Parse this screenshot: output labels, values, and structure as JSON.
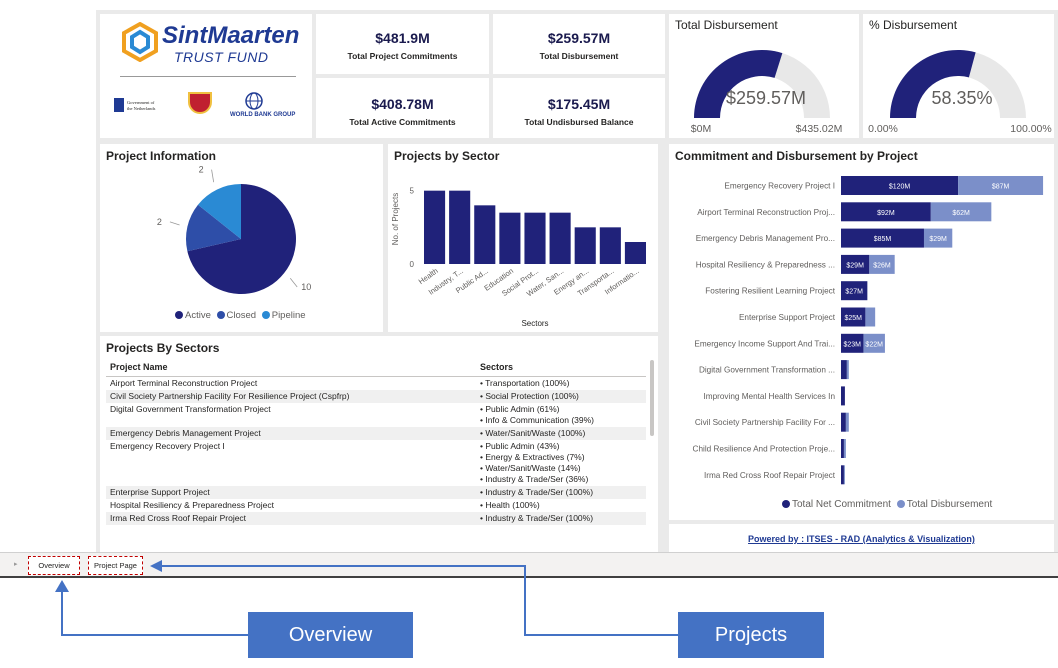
{
  "logo": {
    "name": "SintMaarten",
    "subtitle": "TRUST FUND",
    "partner1_line1": "Government of",
    "partner1_line2": "the Netherlands",
    "partner3": "WORLD BANK GROUP"
  },
  "kpis": {
    "total_project_commitments": {
      "value": "$481.9M",
      "label": "Total Project Commitments"
    },
    "total_disbursement": {
      "value": "$259.57M",
      "label": "Total Disbursement"
    },
    "total_active_commitments": {
      "value": "$408.78M",
      "label": "Total Active Commitments"
    },
    "total_undisbursed": {
      "value": "$175.45M",
      "label": "Total Undisbursed Balance"
    }
  },
  "gauge_disbursement": {
    "title": "Total Disbursement",
    "value": "$259.57M",
    "min": "$0M",
    "max": "$435.02M",
    "fraction": 0.5967
  },
  "gauge_percent": {
    "title": "% Disbursement",
    "value": "58.35%",
    "min": "0.00%",
    "max": "100.00%",
    "fraction": 0.5835
  },
  "project_info": {
    "title": "Project Information",
    "legend": [
      "Active",
      "Closed",
      "Pipeline"
    ],
    "colors": [
      "#20227a",
      "#2e4ea8",
      "#2a8ad4"
    ]
  },
  "sector_chart": {
    "title": "Projects by Sector"
  },
  "commit_chart": {
    "title": "Commitment and Disbursement by Project"
  },
  "chart_data": [
    {
      "type": "pie",
      "labels": [
        "Active",
        "Closed",
        "Pipeline"
      ],
      "values": [
        10,
        2,
        2
      ],
      "colors": [
        "#20227a",
        "#2e4ea8",
        "#2a8ad4"
      ]
    },
    {
      "type": "bar",
      "title": "Projects by Sector",
      "xlabel": "Sectors",
      "ylabel": "No. of Projects",
      "categories": [
        "Health",
        "Industry, T...",
        "Public Ad...",
        "Education",
        "Social Prot...",
        "Water, San...",
        "Energy an...",
        "Transporta...",
        "Informatio..."
      ],
      "values": [
        5,
        5,
        4,
        3.5,
        3.5,
        3.5,
        2.5,
        2.5,
        1.5
      ],
      "ytick": [
        "0",
        "5"
      ],
      "ylim": [
        0,
        6
      ],
      "color": "#20227a"
    },
    {
      "type": "bar",
      "orientation": "horizontal",
      "title": "Commitment and Disbursement by Project",
      "categories": [
        "Emergency Recovery Project I",
        "Airport Terminal Reconstruction Proj...",
        "Emergency Debris Management Pro...",
        "Hospital Resiliency & Preparedness ...",
        "Fostering Resilient Learning Project",
        "Enterprise Support Project",
        "Emergency Income Support And Trai...",
        "Digital Government Transformation ...",
        "Improving Mental Health Services In",
        "Civil Society Partnership Facility For ...",
        "Child Resilience And Protection Proje...",
        "Irma Red Cross Roof Repair Project"
      ],
      "series": [
        {
          "name": "Total Net Commitment",
          "values": [
            120,
            92,
            85,
            29,
            27,
            25,
            23,
            6,
            4,
            5,
            3,
            3
          ],
          "labels": [
            "$120M",
            "$92M",
            "$85M",
            "$29M",
            "$27M",
            "$25M",
            "$23M",
            "",
            "",
            "",
            "",
            ""
          ],
          "color": "#20227a"
        },
        {
          "name": "Total Disbursement",
          "values": [
            87,
            62,
            29,
            26,
            0,
            10,
            22,
            2,
            0,
            3,
            2,
            1
          ],
          "labels": [
            "$87M",
            "$62M",
            "$29M",
            "$26M",
            "",
            "",
            "$22M",
            "",
            "",
            "",
            "",
            ""
          ],
          "color": "#7b8fc9"
        }
      ]
    }
  ],
  "sectors_table": {
    "title": "Projects By Sectors",
    "headers": [
      "Project Name",
      "Sectors"
    ],
    "rows": [
      {
        "name": "Airport Terminal Reconstruction Project",
        "sectors": [
          "• Transportation (100%)"
        ]
      },
      {
        "name": "Civil Society Partnership Facility For Resilience Project (Cspfrp)",
        "sectors": [
          "• Social Protection (100%)"
        ]
      },
      {
        "name": "Digital Government Transformation Project",
        "sectors": [
          "• Public Admin (61%)",
          "• Info & Communication (39%)"
        ]
      },
      {
        "name": "Emergency Debris Management Project",
        "sectors": [
          "• Water/Sanit/Waste (100%)"
        ]
      },
      {
        "name": "Emergency Recovery Project I",
        "sectors": [
          "• Public Admin (43%)",
          "• Energy & Extractives (7%)",
          "• Water/Sanit/Waste (14%)",
          "• Industry & Trade/Ser (36%)"
        ]
      },
      {
        "name": "Enterprise Support Project",
        "sectors": [
          "• Industry & Trade/Ser (100%)"
        ]
      },
      {
        "name": "Hospital Resiliency & Preparedness Project",
        "sectors": [
          "• Health (100%)"
        ]
      },
      {
        "name": "Irma Red Cross Roof Repair Project",
        "sectors": [
          "• Industry & Trade/Ser (100%)"
        ]
      }
    ]
  },
  "powered_by": "Powered by : ITSES - RAD (Analytics & Visualization)",
  "tabs": {
    "overview": "Overview",
    "project_page": "Project Page"
  },
  "callouts": {
    "overview": "Overview",
    "projects": "Projects"
  },
  "colors": {
    "navy": "#20227a",
    "light_series": "#7b8fc9",
    "callout": "#4472c4",
    "tab_border": "#c00000"
  }
}
